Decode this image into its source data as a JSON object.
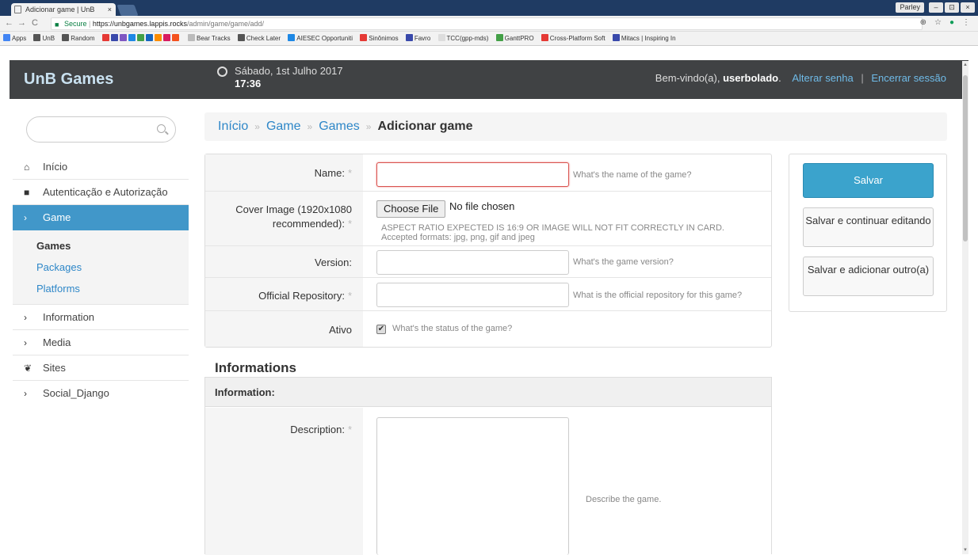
{
  "browser": {
    "tab_title": "Adicionar game | UnB",
    "tab_close": "×",
    "profile": "Parley",
    "window_buttons": [
      "–",
      "⊡",
      "×"
    ],
    "url_secure": "Secure",
    "url_host": "https://unbgames.lappis.rocks",
    "url_path": "/admin/game/game/add/",
    "bookmarks": [
      "Apps",
      "UnB",
      "Random",
      "Bear Tracks",
      "Check Later",
      "AIESEC Opportuniti",
      "Sinônimos",
      "Favro",
      "TCC(gpp-mds)",
      "GanttPRO",
      "Cross-Platform Soft",
      "Mitacs | Inspiring In"
    ]
  },
  "header": {
    "brand": "UnB Games",
    "date": "Sábado, 1st Julho 2017",
    "time": "17:36",
    "welcome": "Bem-vindo(a),",
    "username": "userbolado",
    "change_password": "Alterar senha",
    "logout": "Encerrar sessão"
  },
  "sidebar": {
    "search_placeholder": "",
    "items": [
      {
        "label": "Início",
        "icon": "home-icon"
      },
      {
        "label": "Autenticação e Autorização",
        "icon": "lock-icon"
      },
      {
        "label": "Game",
        "icon": "chevron-right-icon"
      },
      {
        "label": "Information",
        "icon": "chevron-right-icon"
      },
      {
        "label": "Media",
        "icon": "chevron-right-icon"
      },
      {
        "label": "Sites",
        "icon": "leaf-icon"
      },
      {
        "label": "Social_Django",
        "icon": "chevron-right-icon"
      }
    ],
    "subitems": [
      "Games",
      "Packages",
      "Platforms"
    ]
  },
  "breadcrumb": {
    "items": [
      "Início",
      "Game",
      "Games"
    ],
    "current": "Adicionar game"
  },
  "form": {
    "name_label": "Name:",
    "name_help": "What's the name of the game?",
    "cover_label_1": "Cover Image (1920x1080",
    "cover_label_2": "recommended):",
    "choose_file": "Choose File",
    "no_file": "No file chosen",
    "cover_help": "ASPECT RATIO EXPECTED IS 16:9 OR IMAGE WILL NOT FIT CORRECTLY IN CARD. Accepted formats: jpg, png, gif and jpeg",
    "version_label": "Version:",
    "version_help": "What's the game version?",
    "repo_label": "Official Repository:",
    "repo_help": "What is the official repository for this game?",
    "active_label": "Ativo",
    "active_help": "What's the status of the game?",
    "required_mark": "*"
  },
  "actions": {
    "save": "Salvar",
    "save_continue": "Salvar e continuar editando",
    "save_add": "Salvar e adicionar outro(a)"
  },
  "informations": {
    "title": "Informations",
    "group_title": "Information:",
    "description_label": "Description:",
    "description_help": "Describe the game."
  }
}
